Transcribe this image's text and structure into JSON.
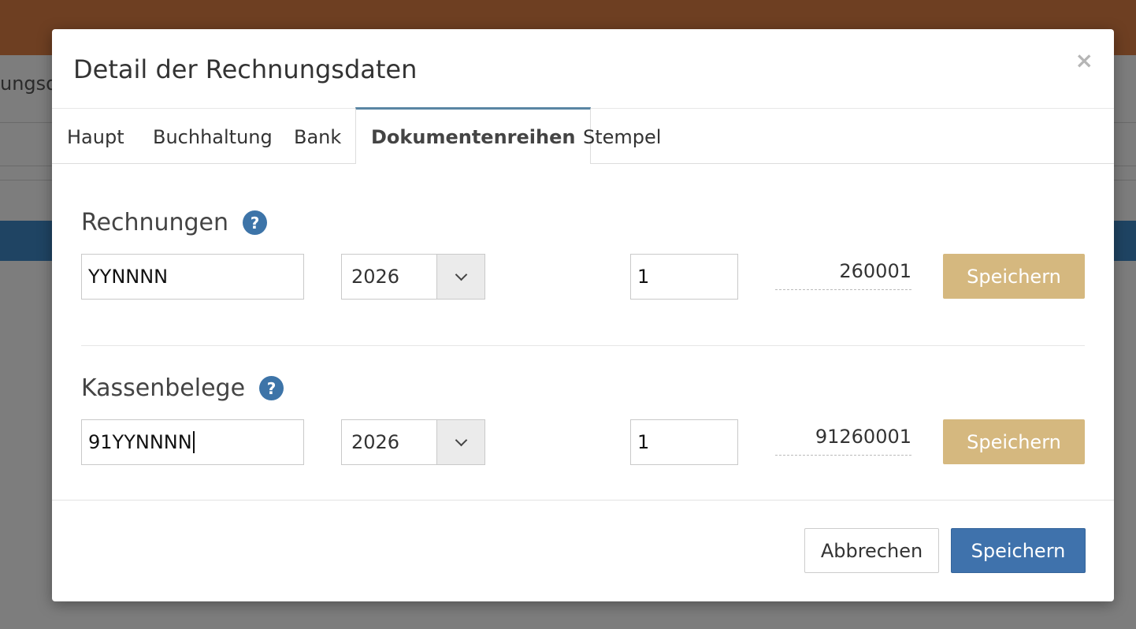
{
  "background": {
    "page_title_fragment": "ungsda"
  },
  "modal": {
    "title": "Detail der Rechnungsdaten",
    "close_symbol": "×",
    "tabs": [
      {
        "label": "Haupt",
        "active": false
      },
      {
        "label": "Buchhaltung",
        "active": false
      },
      {
        "label": "Bank",
        "active": false
      },
      {
        "label": "Dokumentenreihen",
        "active": true
      },
      {
        "label": "Stempel",
        "active": false
      }
    ],
    "sections": [
      {
        "title": "Rechnungen",
        "help_symbol": "?",
        "format_value": "YYNNNN",
        "year_value": "2026",
        "counter_value": "1",
        "preview": "260001",
        "save_label": "Speichern"
      },
      {
        "title": "Kassenbelege",
        "help_symbol": "?",
        "format_value": "91YYNNNN",
        "year_value": "2026",
        "counter_value": "1",
        "preview": "91260001",
        "save_label": "Speichern"
      }
    ],
    "footer": {
      "cancel_label": "Abbrechen",
      "save_label": "Speichern"
    }
  },
  "colors": {
    "gold_button": "#d5b87f",
    "primary_button": "#3f72ac",
    "help_icon": "#3d74a8",
    "active_tab_accent": "#5a86a3"
  },
  "icons": {
    "close": "close-icon",
    "help": "help-icon",
    "dropdown": "chevron-down-icon"
  }
}
